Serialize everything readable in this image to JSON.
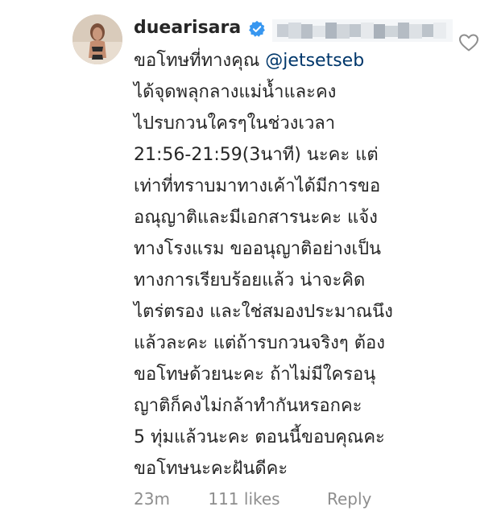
{
  "comment": {
    "username": "duearisara",
    "mention": "@jetsetseb",
    "lines": [
      "ขอโทษที่ทางคุณ ",
      "ได้จุดพลุกลางแม่น้ำและคง",
      "ไปรบกวนใครๆในช่วงเวลา",
      "21:56-21:59(3นาที) นะคะ แต่",
      "เท่าที่ทราบมาทางเค้าได้มีการขอ",
      "อณุญาติและมีเอกสารนะคะ แจ้ง",
      "ทางโรงแรม ขออนุญาติอย่างเป็น",
      "ทางการเรียบร้อยแล้ว น่าจะคิด",
      "ไตร่ตรอง และใช่สมองประมาณนึง",
      "แล้วละคะ แต่ถ้ารบกวนจริงๆ ต้อง",
      "ขอโทษด้วยนะคะ ถ้าไม่มีใครอนุ",
      "ญาติก็คงไม่กล้าทำกันหรอกคะ",
      "5 ทุ่มแล้วนะคะ ตอนนี้ขอบคุณคะ",
      "ขอโทษนะคะฝันดีคะ"
    ],
    "time": "23m",
    "likes": "111 likes",
    "reply_label": "Reply"
  },
  "icons": {
    "verified": "verified-badge-icon",
    "like": "heart-outline-icon"
  },
  "colors": {
    "text": "#262626",
    "mention": "#00376b",
    "meta": "#8e8e8e",
    "verified": "#3897f0"
  }
}
